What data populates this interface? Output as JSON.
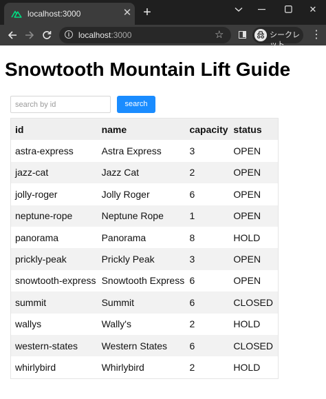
{
  "browser": {
    "tab": {
      "title": "localhost:3000",
      "favicon": "nuxt-logo-icon"
    },
    "url_host": "localhost",
    "url_port": ":3000",
    "profile_label": "シークレット",
    "accent": "#00dc82"
  },
  "page": {
    "title": "Snowtooth Mountain Lift Guide",
    "search": {
      "placeholder": "search by id",
      "value": "",
      "button_label": "search",
      "button_color": "#1a8cff"
    }
  },
  "table": {
    "headers": {
      "id": "id",
      "name": "name",
      "capacity": "capacity",
      "status": "status"
    },
    "rows": [
      {
        "id": "astra-express",
        "name": "Astra Express",
        "capacity": "3",
        "status": "OPEN"
      },
      {
        "id": "jazz-cat",
        "name": "Jazz Cat",
        "capacity": "2",
        "status": "OPEN"
      },
      {
        "id": "jolly-roger",
        "name": "Jolly Roger",
        "capacity": "6",
        "status": "OPEN"
      },
      {
        "id": "neptune-rope",
        "name": "Neptune Rope",
        "capacity": "1",
        "status": "OPEN"
      },
      {
        "id": "panorama",
        "name": "Panorama",
        "capacity": "8",
        "status": "HOLD"
      },
      {
        "id": "prickly-peak",
        "name": "Prickly Peak",
        "capacity": "3",
        "status": "OPEN"
      },
      {
        "id": "snowtooth-express",
        "name": "Snowtooth Express",
        "capacity": "6",
        "status": "OPEN"
      },
      {
        "id": "summit",
        "name": "Summit",
        "capacity": "6",
        "status": "CLOSED"
      },
      {
        "id": "wallys",
        "name": "Wally's",
        "capacity": "2",
        "status": "HOLD"
      },
      {
        "id": "western-states",
        "name": "Western States",
        "capacity": "6",
        "status": "CLOSED"
      },
      {
        "id": "whirlybird",
        "name": "Whirlybird",
        "capacity": "2",
        "status": "HOLD"
      }
    ]
  }
}
